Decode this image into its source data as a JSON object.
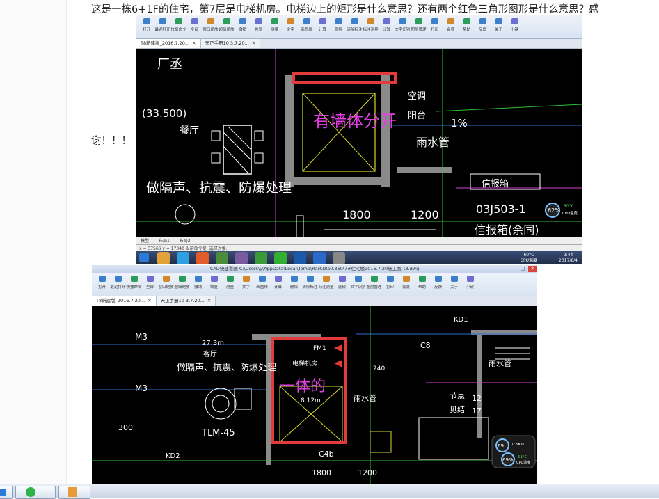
{
  "post": {
    "line1": "这是一栋6+1F的住宅，第7层是电梯机房。电梯边上的矩形是什么意思？还有两个红色三角形图形是什么意思？感",
    "line2": "谢！！！"
  },
  "toolbar_labels": [
    "打开",
    "最近打开",
    "快捷命令",
    "全部",
    "窗口缩放",
    "超级缩放",
    "撤销",
    "恢复",
    "测量",
    "文字",
    "画图线",
    "计算",
    "删除",
    "清除标注",
    "标注测量",
    "比较",
    "文字识别",
    "图层管理",
    "打印",
    "会员",
    "帮助",
    "反馈",
    "关于",
    "小键"
  ],
  "shot1": {
    "tabs": [
      {
        "label": "T8新建版_2016.7.20..."
      },
      {
        "label": "天正手册10 3.7.20..."
      }
    ],
    "annotation": "有墙体分开",
    "cad_text": {
      "room_top": "厂丞",
      "code": "(33.500)",
      "dining": "餐厅",
      "scope": "做隔声、抗震、防爆处理",
      "right1": "空调",
      "right2": "阳台",
      "pct": "1%",
      "downpipe": "雨水管",
      "pipe_box": "信报箱",
      "dim1": "1800",
      "dim2": "1200",
      "ref": "03J503-1",
      "mailbox": "信报箱(余同)"
    },
    "cpu_badge": "62%",
    "cpu_temp": "60°C",
    "cpu_label": "CPU温度",
    "model_tabs": [
      "模型",
      "布局1",
      "布局2"
    ],
    "status": "x = 37566 y = 17340   当前命令是: 选择对象:",
    "clock_time": "9:44",
    "clock_date": "2017/8/4"
  },
  "shot2": {
    "title": "CAD快速看图  C:\\Users\\y\\AppData\\Local\\Temp\\Rar$DIa0.860\\7#住宅楼2016.7.20施工图_t3.dwg",
    "tabs": [
      {
        "label": "T8新建版_2016.7.20..."
      },
      {
        "label": "天正手册10 3.7.20..."
      }
    ],
    "annotation": "一体的",
    "cad_text": {
      "height": "27.3m",
      "room": "客厅",
      "scope": "做隔声、抗震、防爆处理",
      "lift_room": "电梯机房",
      "fm": "FM1",
      "m3a": "M3",
      "m3b": "M3",
      "ldm": "TLM-45",
      "kd1": "KD1",
      "kd2": "KD2",
      "c8": "C8",
      "downpipe": "雨水管",
      "node": "节点",
      "ref": "见结",
      "n12": "12",
      "n17": "17",
      "lift_h": "8.12m",
      "c4": "C4b",
      "d1": "1800",
      "d2": "1200",
      "d3": "300",
      "d4": "240"
    },
    "cpu_badge": "69%",
    "cpu_small": "69",
    "cpu_temp": "51°C",
    "cpu_label": "CPU温度",
    "net_speed": "0.5K/s"
  },
  "colors": {
    "annotation_red": "#e23b3b",
    "annotation_text": "#e040e0",
    "cad_bg": "#000000"
  }
}
